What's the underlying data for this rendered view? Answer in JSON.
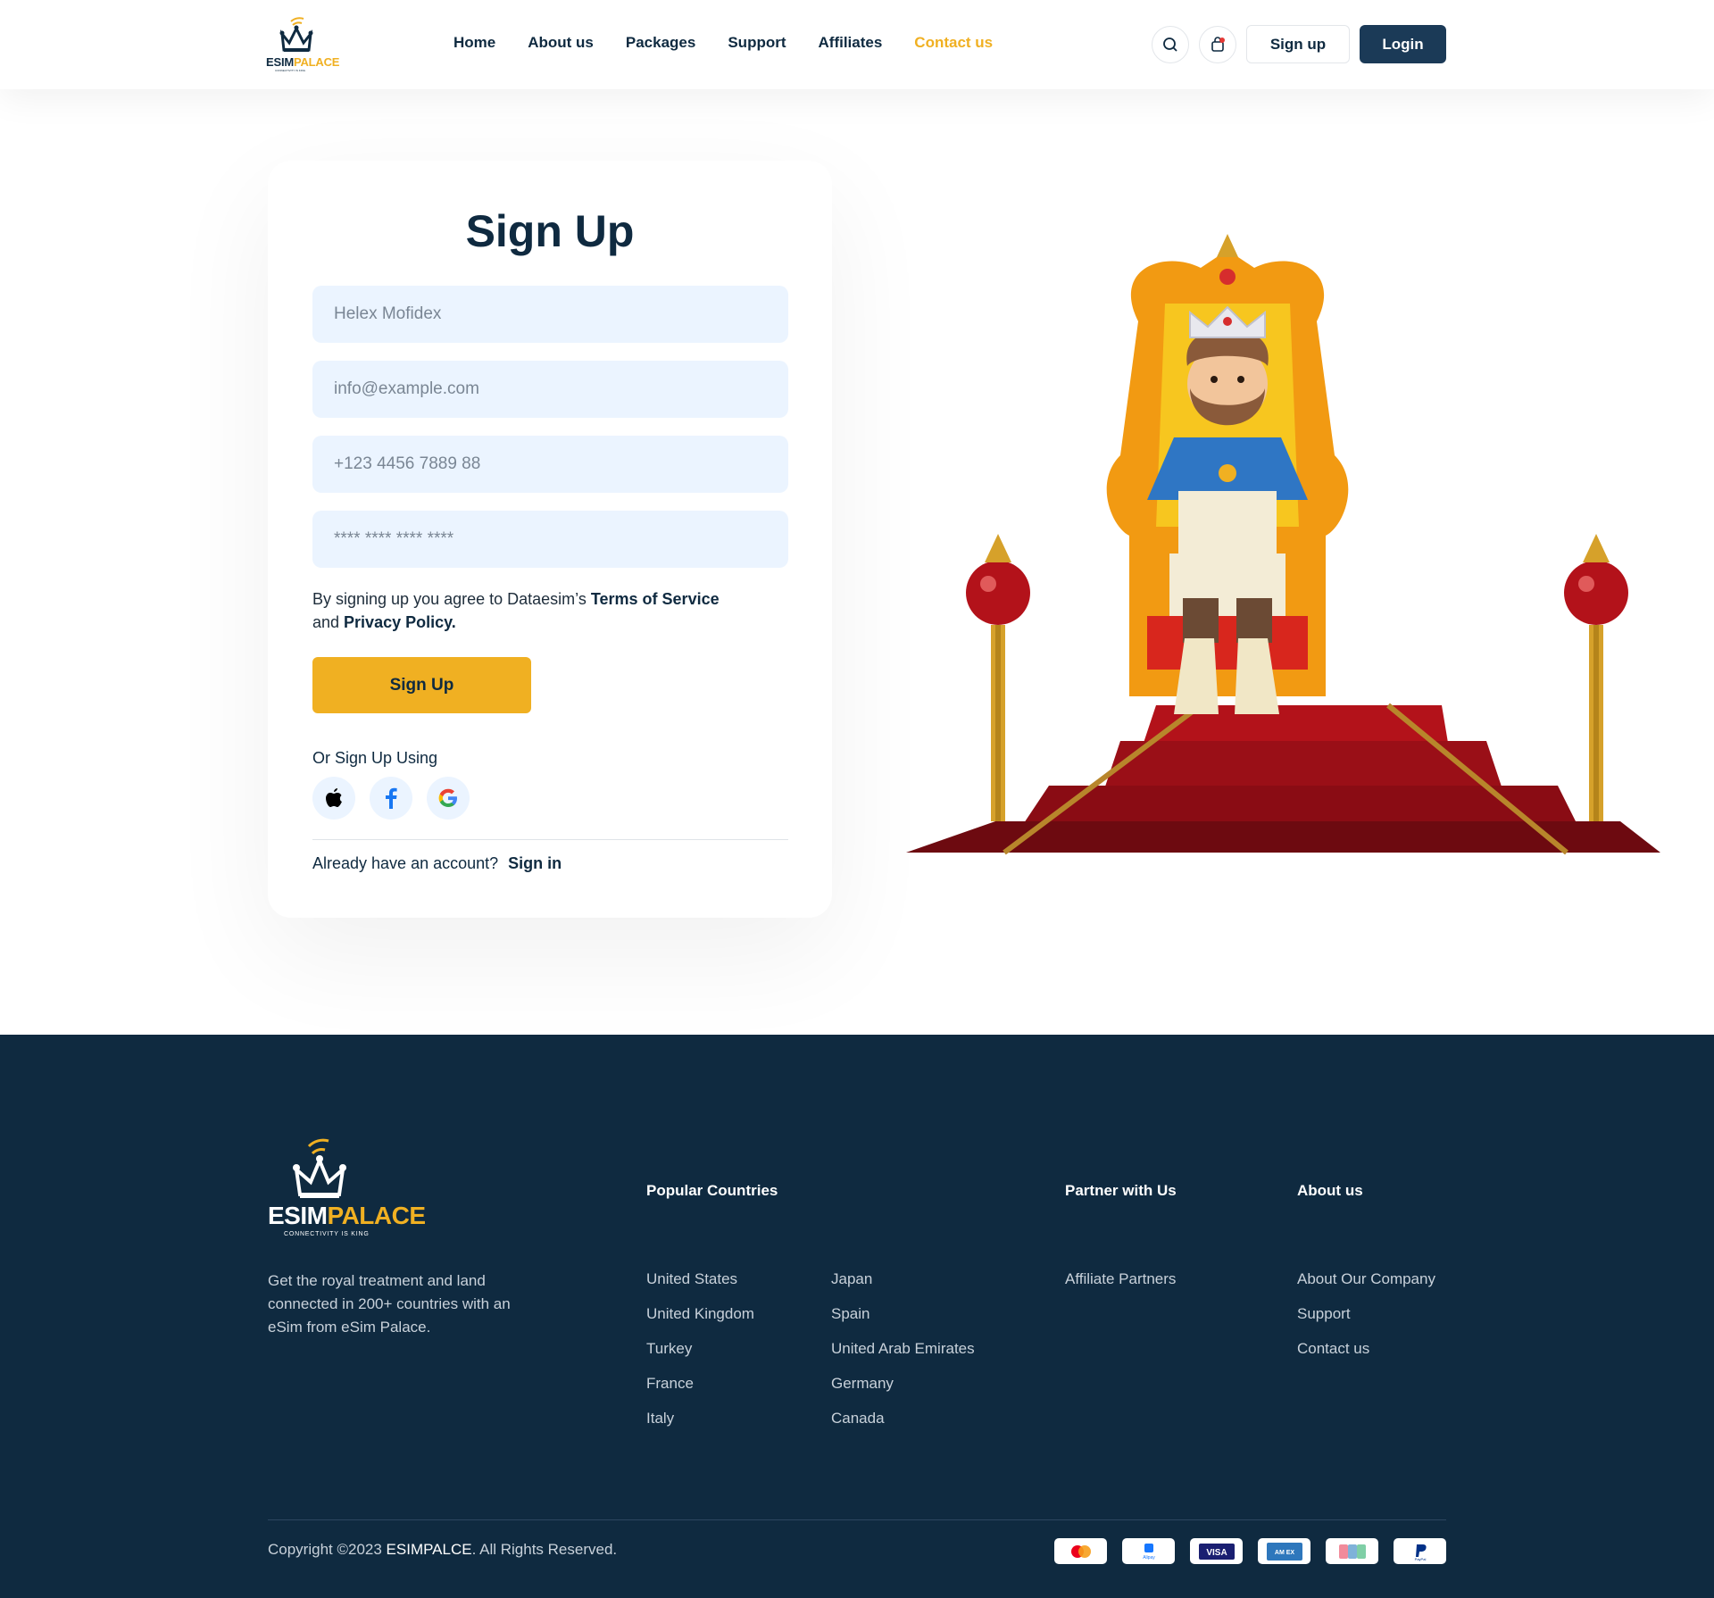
{
  "header": {
    "logo": {
      "part1": "ESIM",
      "part2": "PALACE",
      "tagline": "CONNECTIVITY IS KING"
    },
    "nav": [
      {
        "label": "Home",
        "active": false
      },
      {
        "label": "About us",
        "active": false
      },
      {
        "label": "Packages",
        "active": false
      },
      {
        "label": "Support",
        "active": false
      },
      {
        "label": "Affiliates",
        "active": false
      },
      {
        "label": "Contact us",
        "active": true
      }
    ],
    "search_icon": "search-icon",
    "cart_icon": "shopping-bag-icon",
    "signup_label": "Sign up",
    "login_label": "Login"
  },
  "form": {
    "title": "Sign Up",
    "name_placeholder": "Helex Mofidex",
    "email_placeholder": "info@example.com",
    "phone_placeholder": "+123 4456 7889 88",
    "password_placeholder": "**** **** **** ****",
    "agree_prefix": "By signing up you agree to Dataesim’s ",
    "terms": "Terms of Service",
    "agree_and": " and ",
    "privacy": "Privacy Policy.",
    "submit_label": "Sign Up",
    "or_label": "Or Sign Up Using",
    "social": [
      "apple-icon",
      "facebook-icon",
      "google-icon"
    ],
    "have_account": "Already have an account?",
    "signin_label": "Sign in"
  },
  "footer": {
    "logo": {
      "part1": "ESIM",
      "part2": "PALACE",
      "tagline": "CONNECTIVITY IS KING"
    },
    "description": "Get the royal treatment and land connected in 200+ countries with an eSim from eSim Palace.",
    "popular_heading": "Popular Countries",
    "countries_col1": [
      "United States",
      "United Kingdom",
      "Turkey",
      "France",
      "Italy"
    ],
    "countries_col2": [
      "Japan",
      "Spain",
      "United Arab Emirates",
      "Germany",
      "Canada"
    ],
    "partner_heading": "Partner with Us",
    "partner_links": [
      "Affiliate Partners"
    ],
    "about_heading": "About us",
    "about_links": [
      "About Our Company",
      "Support",
      "Contact us"
    ],
    "copyright_prefix": "Copyright ©2023 ",
    "copyright_brand": "ESIMPALCE",
    "copyright_suffix": ". All Rights Reserved.",
    "payment_icons": [
      "mastercard-icon",
      "alipay-icon",
      "visa-icon",
      "amex-icon",
      "jcb-icon",
      "paypal-icon"
    ],
    "alipay_text": "Alipay",
    "visa_text": "VISA",
    "amex_text": "AM EX",
    "paypal_text": "PayPal"
  },
  "colors": {
    "navy": "#0f2a40",
    "accent": "#f0b022",
    "login_button": "#1b3a57",
    "input_bg": "#ebf4ff"
  }
}
